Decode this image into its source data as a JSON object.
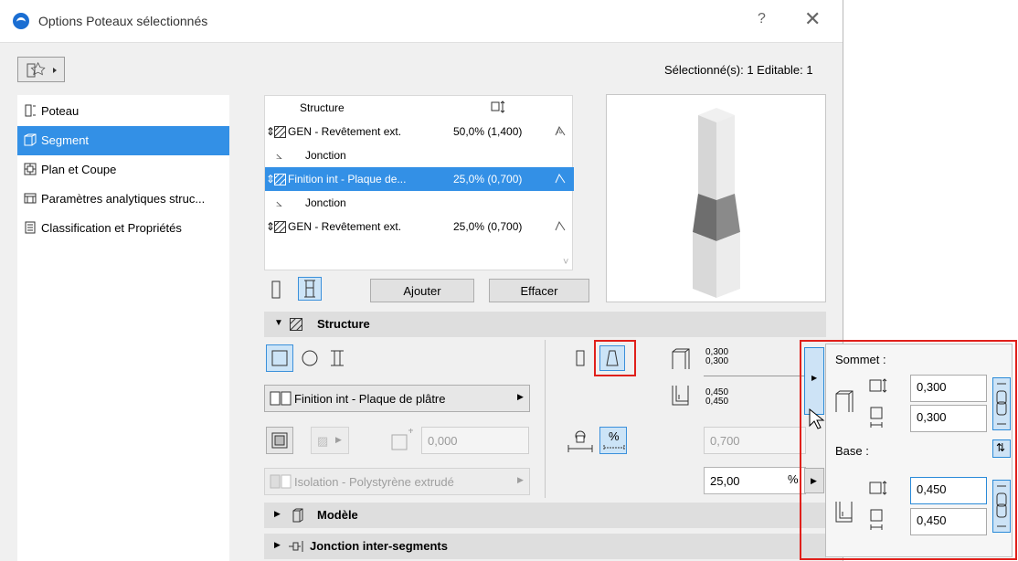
{
  "window": {
    "title": "Options Poteaux sélectionnés",
    "help": "?",
    "close": "✕"
  },
  "header": {
    "selection_info": "Sélectionné(s): 1 Editable: 1"
  },
  "sidebar": {
    "items": [
      {
        "label": "Poteau",
        "icon": "column-icon"
      },
      {
        "label": "Segment",
        "icon": "segment-icon"
      },
      {
        "label": "Plan et Coupe",
        "icon": "floor-plan-icon"
      },
      {
        "label": "Paramètres analytiques struc...",
        "icon": "analytic-icon"
      },
      {
        "label": "Classification et Propriétés",
        "icon": "properties-icon"
      }
    ]
  },
  "structure_table": {
    "header": {
      "col_name": "Structure"
    },
    "rows": [
      {
        "name": "GEN - Revêtement ext.",
        "value": "50,0% (1,400)",
        "type": "segment"
      },
      {
        "name": "Jonction",
        "type": "joint"
      },
      {
        "name": "Finition int - Plaque de...",
        "value": "25,0% (0,700)",
        "type": "segment"
      },
      {
        "name": "Jonction",
        "type": "joint"
      },
      {
        "name": "GEN - Revêtement ext.",
        "value": "25,0% (0,700)",
        "type": "segment"
      }
    ]
  },
  "buttons": {
    "add": "Ajouter",
    "delete": "Effacer"
  },
  "sections": {
    "structure": "Structure",
    "model": "Modèle",
    "junction": "Jonction inter-segments"
  },
  "structure_panel": {
    "material": "Finition int - Plaque de plâtre",
    "core_value": "0,000",
    "insulation": "Isolation - Polystyrène extrudé",
    "top_dims": [
      "0,300",
      "0,300"
    ],
    "base_dims": [
      "0,450",
      "0,450"
    ],
    "length_value": "0,700",
    "percent_value": "25,00",
    "percent_unit": "%"
  },
  "popup": {
    "top_label": "Sommet :",
    "top_width": "0,300",
    "top_depth": "0,300",
    "base_label": "Base :",
    "base_width": "0,450",
    "base_depth": "0,450"
  },
  "colors": {
    "selection": "#3390e6",
    "highlight": "#e0201b"
  }
}
